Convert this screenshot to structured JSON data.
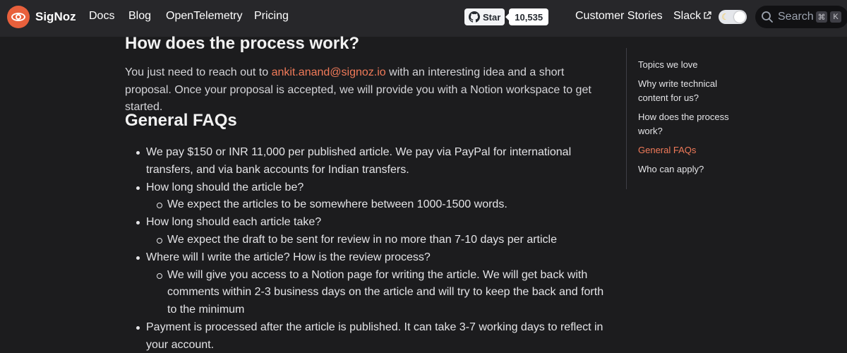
{
  "navbar": {
    "brand": "SigNoz",
    "links": [
      "Docs",
      "Blog",
      "OpenTelemetry",
      "Pricing"
    ],
    "github": {
      "label": "Star",
      "count": "10,535"
    },
    "right_links": [
      "Customer Stories",
      "Slack"
    ],
    "search": {
      "label": "Search",
      "shortcut_keys": [
        "⌘",
        "K"
      ]
    }
  },
  "main": {
    "process_heading": "How does the process work?",
    "process_text_before": "You just need to reach out to ",
    "process_email": "ankit.anand@signoz.io",
    "process_text_after": " with an interesting idea and a short proposal. Once your proposal is accepted, we will provide you with a Notion workspace to get started.",
    "faq_heading": "General FAQs",
    "faq_items": [
      {
        "text": "We pay $150 or INR 11,000 per published article. We pay via PayPal for international transfers, and via bank accounts for Indian transfers.",
        "sub": ""
      },
      {
        "text": "How long should the article be?",
        "sub": "We expect the articles to be somewhere between 1000-1500 words."
      },
      {
        "text": "How long should each article take?",
        "sub": "We expect the draft to be sent for review in no more than 7-10 days per article"
      },
      {
        "text": "Where will I write the article? How is the review process?",
        "sub": "We will give you access to a Notion page for writing the article. We will get back with comments within 2-3 business days on the article and will try to keep the back and forth to the minimum"
      },
      {
        "text": "Payment is processed after the article is published. It can take 3-7 working days to reflect in your account.",
        "sub": ""
      }
    ]
  },
  "toc": {
    "items": [
      "Topics we love",
      "Why write technical content for us?",
      "How does the process work?",
      "General FAQs",
      "Who can apply?"
    ],
    "active": "General FAQs"
  },
  "colors": {
    "accent": "#f07a59",
    "brand": "#e8603c",
    "background": "#1c1c1e",
    "navbar": "#27272a"
  }
}
